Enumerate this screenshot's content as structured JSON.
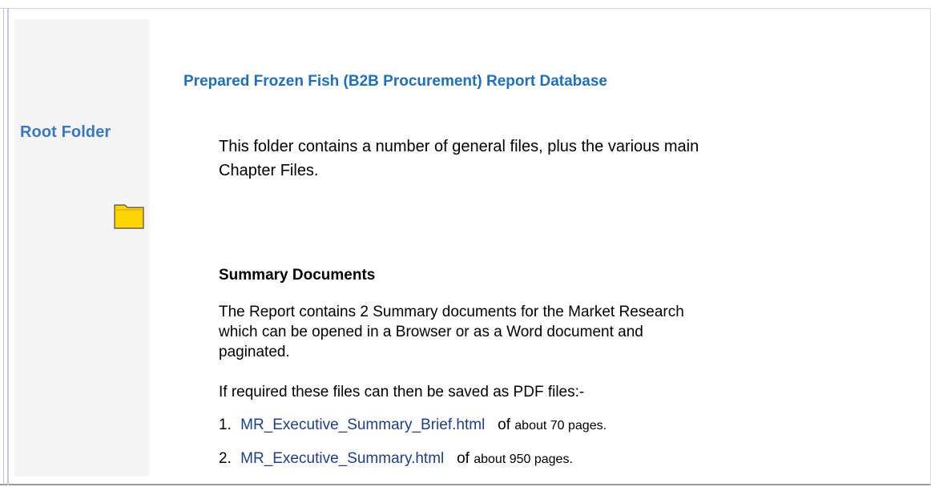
{
  "sidebar": {
    "label": "Root Folder",
    "icon": "folder-icon"
  },
  "main": {
    "title": "Prepared Frozen Fish (B2B Procurement) Report Database",
    "intro": "This folder contains a number of general files, plus the various main Chapter Files.",
    "summary_heading": "Summary Documents",
    "summary_text": "The Report contains 2 Summary documents for the Market Research which can be opened in a Browser or as a Word document and paginated.",
    "pdf_note": "If required these files can then be saved as PDF files:-",
    "files": [
      {
        "number": "1.",
        "link": "MR_Executive_Summary_Brief.html",
        "of": "of",
        "pages": "about 70 pages."
      },
      {
        "number": "2.",
        "link": "MR_Executive_Summary.html",
        "of": "of",
        "pages": "about 950 pages."
      }
    ]
  },
  "colors": {
    "label": "#3a78c4",
    "title": "#1f6fbf",
    "link": "#1d3f8a",
    "sidebar_bg": "#f5f5f5",
    "folder": "#ffd700"
  }
}
